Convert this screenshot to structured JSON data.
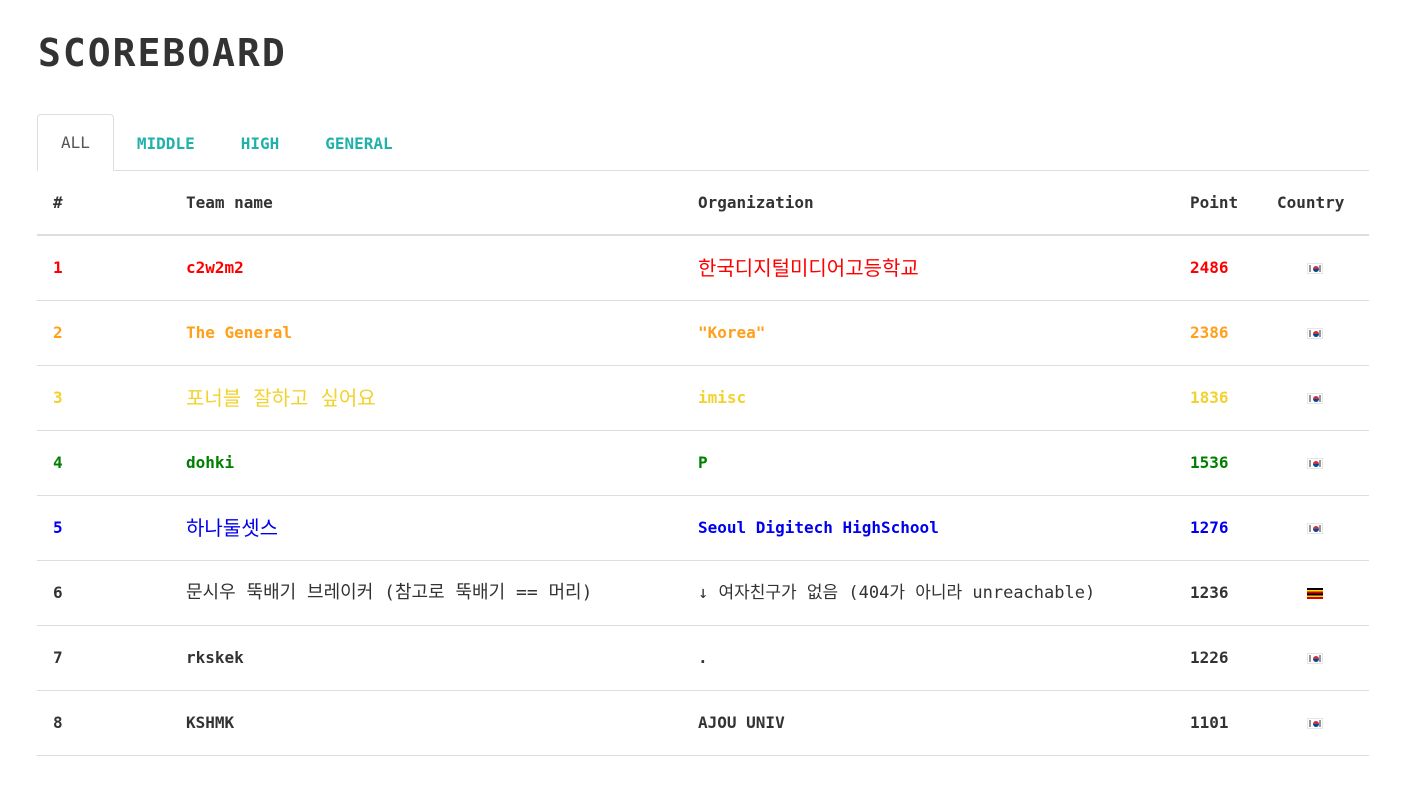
{
  "page": {
    "title": "SCOREBOARD"
  },
  "tabs": [
    {
      "label": "ALL",
      "active": true
    },
    {
      "label": "MIDDLE",
      "active": false
    },
    {
      "label": "HIGH",
      "active": false
    },
    {
      "label": "GENERAL",
      "active": false
    }
  ],
  "table": {
    "headers": {
      "rank": "#",
      "team": "Team name",
      "organization": "Organization",
      "point": "Point",
      "country": "Country"
    },
    "rows": [
      {
        "rank": "1",
        "team": "c2w2m2",
        "organization": "한국디지털미디어고등학교",
        "point": "2486",
        "country_icon": "south-korea-flag-icon",
        "color": "#ff0000"
      },
      {
        "rank": "2",
        "team": "The General",
        "organization": "\"Korea\"",
        "point": "2386",
        "country_icon": "south-korea-flag-icon",
        "color": "#ff9f1a"
      },
      {
        "rank": "3",
        "team": "포너블 잘하고 싶어요",
        "organization": "imisc",
        "point": "1836",
        "country_icon": "south-korea-flag-icon",
        "color": "#f2d22e"
      },
      {
        "rank": "4",
        "team": "dohki",
        "organization": "P",
        "point": "1536",
        "country_icon": "south-korea-flag-icon",
        "color": "#008000"
      },
      {
        "rank": "5",
        "team": "하나둘셋스",
        "organization": "Seoul Digitech HighSchool",
        "point": "1276",
        "country_icon": "south-korea-flag-icon",
        "color": "#0000ee"
      },
      {
        "rank": "6",
        "team": "문시우 뚝배기 브레이커 (참고로 뚝배기 == 머리)",
        "organization": "↓ 여자친구가 없음 (404가 아니라 unreachable)",
        "point": "1236",
        "country_icon": "uganda-flag-icon",
        "color": "#333333"
      },
      {
        "rank": "7",
        "team": "rkskek",
        "organization": ".",
        "point": "1226",
        "country_icon": "south-korea-flag-icon",
        "color": "#333333"
      },
      {
        "rank": "8",
        "team": "KSHMK",
        "organization": "AJOU UNIV",
        "point": "1101",
        "country_icon": "south-korea-flag-icon",
        "color": "#333333"
      }
    ]
  }
}
